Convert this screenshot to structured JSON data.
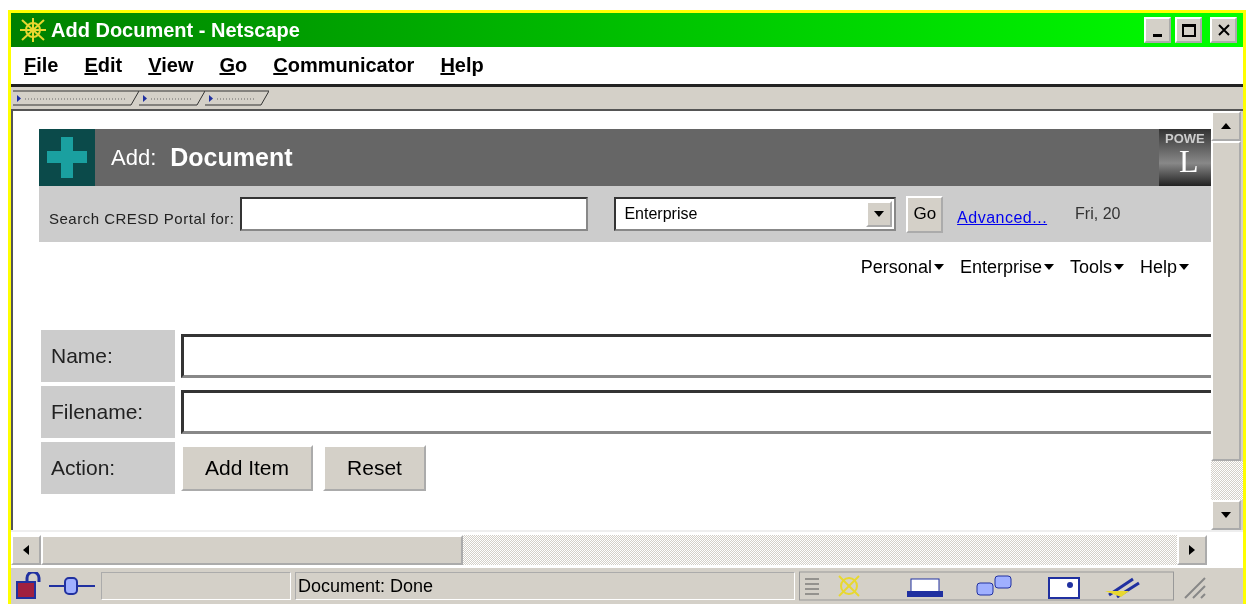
{
  "window": {
    "title": "Add Document - Netscape"
  },
  "menu": [
    {
      "label": "File"
    },
    {
      "label": "Edit"
    },
    {
      "label": "View"
    },
    {
      "label": "Go"
    },
    {
      "label": "Communicator"
    },
    {
      "label": "Help"
    }
  ],
  "header": {
    "prefix": "Add:",
    "title": "Document",
    "logo_lines": [
      "POWE",
      "L"
    ]
  },
  "search": {
    "label": "Search CRESD Portal for:",
    "scope": "Enterprise",
    "go": "Go",
    "advanced": "Advanced...",
    "date": "Fri, 20"
  },
  "nav": [
    {
      "label": "Personal"
    },
    {
      "label": "Enterprise"
    },
    {
      "label": "Tools"
    },
    {
      "label": "Help"
    }
  ],
  "form": [
    {
      "label": "Name:",
      "kind": "text"
    },
    {
      "label": "Filename:",
      "kind": "text"
    },
    {
      "label": "Action:",
      "kind": "buttons",
      "buttons": [
        "Add Item",
        "Reset"
      ]
    }
  ],
  "status_bar": {
    "text": "Document: Done"
  }
}
